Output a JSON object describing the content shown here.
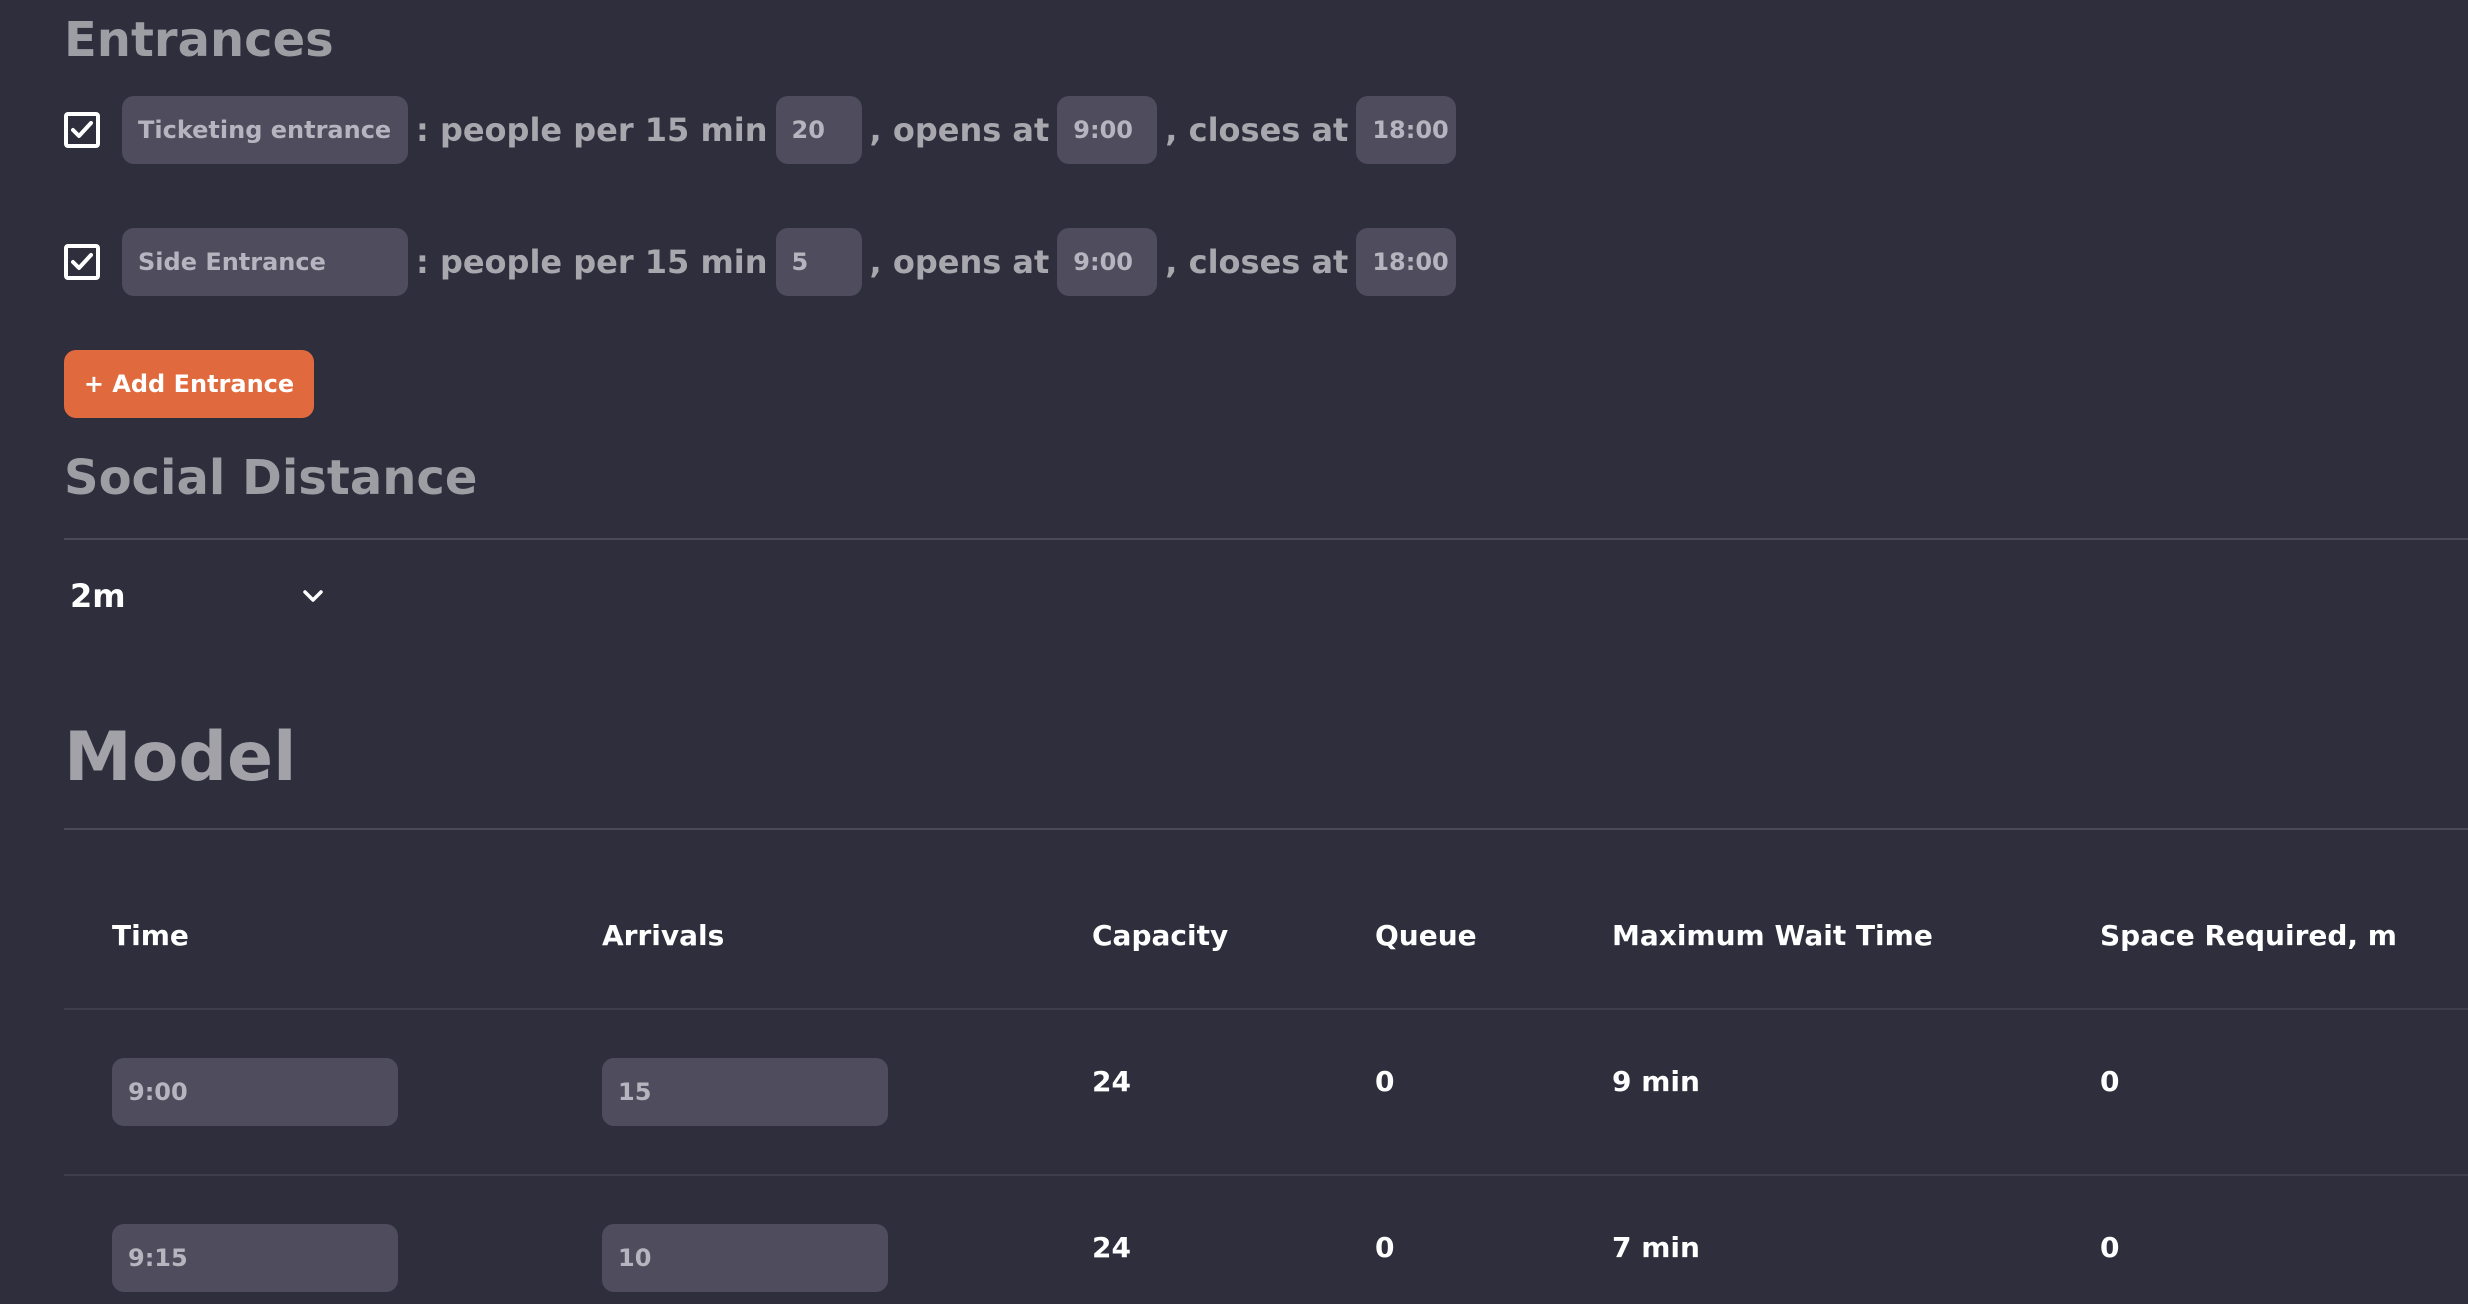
{
  "entrances": {
    "heading": "Entrances",
    "rows": [
      {
        "checked": true,
        "name": "Ticketing entrance",
        "rate_label": ": people per 15 min",
        "rate": "20",
        "opens_label": ", opens at",
        "opens": "9:00",
        "closes_label": ", closes at",
        "closes": "18:00"
      },
      {
        "checked": true,
        "name": "Side Entrance",
        "rate_label": ": people per 15 min",
        "rate": "5",
        "opens_label": ", opens at",
        "opens": "9:00",
        "closes_label": ", closes at",
        "closes": "18:00"
      }
    ],
    "add_button": "+ Add Entrance"
  },
  "social_distance": {
    "heading": "Social Distance",
    "selected": "2m"
  },
  "model": {
    "heading": "Model",
    "columns": [
      "Time",
      "Arrivals",
      "Capacity",
      "Queue",
      "Maximum Wait Time",
      "Space Required, m"
    ],
    "rows": [
      {
        "time": "9:00",
        "arrivals": "15",
        "capacity": "24",
        "queue": "0",
        "max_wait": "9 min",
        "space": "0"
      },
      {
        "time": "9:15",
        "arrivals": "10",
        "capacity": "24",
        "queue": "0",
        "max_wait": "7 min",
        "space": "0"
      }
    ]
  },
  "colors": {
    "background": "#2e2e3c",
    "input": "#4f4d5d",
    "accent": "#e06a3e"
  },
  "icons": {
    "checkbox": "checkmark-icon",
    "dropdown": "chevron-down-icon"
  }
}
